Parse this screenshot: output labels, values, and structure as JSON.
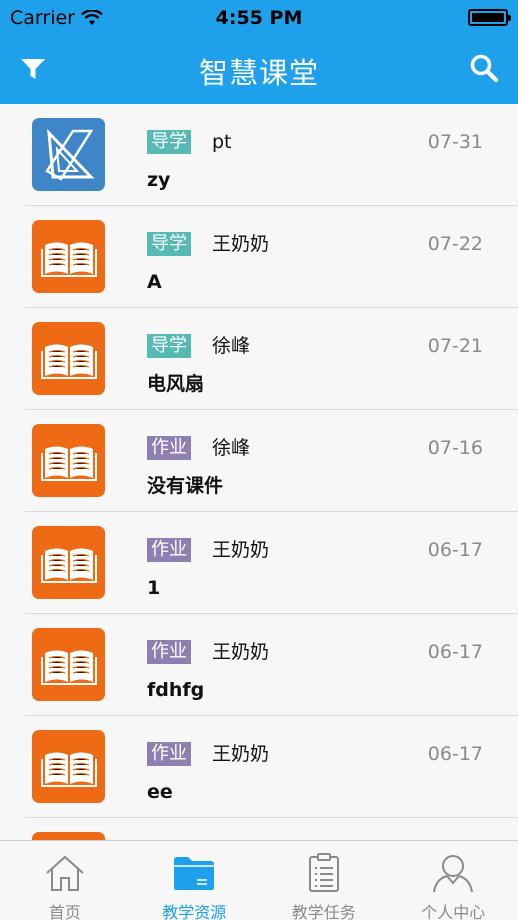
{
  "status_bar": {
    "carrier": "Carrier",
    "time": "4:55 PM"
  },
  "navbar": {
    "title": "智慧课堂",
    "filter_icon": "filter-icon",
    "search_icon": "search-icon"
  },
  "colors": {
    "accent": "#1ea0ea",
    "guide_tag": "#56b9b3",
    "homework_tag": "#8e7fb2",
    "orange_thumb": "#ee6a14",
    "blue_thumb": "#3f86c8"
  },
  "list": {
    "items": [
      {
        "tag": "导学",
        "tag_type": "guide",
        "author": "pt",
        "date": "07-31",
        "name": "zy",
        "icon": "geometry-icon",
        "thumb": "blue"
      },
      {
        "tag": "导学",
        "tag_type": "guide",
        "author": "王奶奶",
        "date": "07-22",
        "name": "A",
        "icon": "book-icon",
        "thumb": "orange"
      },
      {
        "tag": "导学",
        "tag_type": "guide",
        "author": "徐峰",
        "date": "07-21",
        "name": "电风扇",
        "icon": "book-icon",
        "thumb": "orange"
      },
      {
        "tag": "作业",
        "tag_type": "homework",
        "author": "徐峰",
        "date": "07-16",
        "name": "没有课件",
        "icon": "book-icon",
        "thumb": "orange"
      },
      {
        "tag": "作业",
        "tag_type": "homework",
        "author": "王奶奶",
        "date": "06-17",
        "name": "1",
        "icon": "book-icon",
        "thumb": "orange"
      },
      {
        "tag": "作业",
        "tag_type": "homework",
        "author": "王奶奶",
        "date": "06-17",
        "name": "fdhfg",
        "icon": "book-icon",
        "thumb": "orange"
      },
      {
        "tag": "作业",
        "tag_type": "homework",
        "author": "王奶奶",
        "date": "06-17",
        "name": "ee",
        "icon": "book-icon",
        "thumb": "orange"
      },
      {
        "tag": "",
        "tag_type": "",
        "author": "",
        "date": "",
        "name": "",
        "icon": "book-icon",
        "thumb": "orange"
      }
    ]
  },
  "tabbar": {
    "tabs": [
      {
        "label": "首页",
        "icon": "home-icon",
        "active": false
      },
      {
        "label": "教学资源",
        "icon": "folder-icon",
        "active": true
      },
      {
        "label": "教学任务",
        "icon": "clipboard-icon",
        "active": false
      },
      {
        "label": "个人中心",
        "icon": "user-icon",
        "active": false
      }
    ]
  }
}
